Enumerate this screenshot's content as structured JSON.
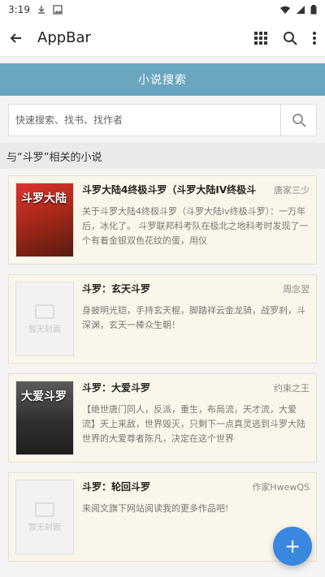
{
  "status": {
    "time": "3:19",
    "left_icons": [
      "download-icon",
      "image-icon"
    ],
    "right_icons": [
      "wifi-icon",
      "signal-icon",
      "battery-icon"
    ]
  },
  "appbar": {
    "title": "AppBar",
    "icons": [
      "back-arrow-icon",
      "grid-icon",
      "search-icon",
      "more-vert-icon"
    ]
  },
  "banner": {
    "label": "小说搜索"
  },
  "search": {
    "placeholder": "快速搜索、找书、找作者"
  },
  "section": {
    "title": "与“斗罗”相关的小说"
  },
  "books": [
    {
      "title": "斗罗大陆4终极斗罗（斗罗大陆IV终极斗",
      "author": "唐家三少",
      "desc": "关于斗罗大陆4终极斗罗（斗罗大陆iv终极斗罗）：一万年后，冰化了。 斗罗联邦科考队在极北之地科考时发现了一个有着金银双色花纹的蛋，用仪",
      "cover": "red",
      "cover_text": "斗罗大陆"
    },
    {
      "title": "斗罗：玄天斗罗",
      "author": "周念翌",
      "desc": "身披明光铠，手持玄天棍，脚踏祥云金龙骑，战罗刹，斗深渊，玄天一棒众生朝！",
      "cover": "placeholder",
      "cover_text": "暂无封面"
    },
    {
      "title": "斗罗：大爱斗罗",
      "author": "约束之王",
      "desc": "【绝世唐门同人，反派，重生，布局流，天才流，大爱流】天上来敌，世界毁灭，只剩下一点真灵逃到斗罗大陆世界的大爱尊者陈凡，决定在这个世界",
      "cover": "dark",
      "cover_text": "大爱斗罗"
    },
    {
      "title": "斗罗：轮回斗罗",
      "author": "作家HwewQS",
      "desc": "来阅文旗下网站阅读我的更多作品吧!",
      "cover": "placeholder",
      "cover_text": "暂无封面"
    }
  ],
  "fab": {
    "label": "+"
  }
}
